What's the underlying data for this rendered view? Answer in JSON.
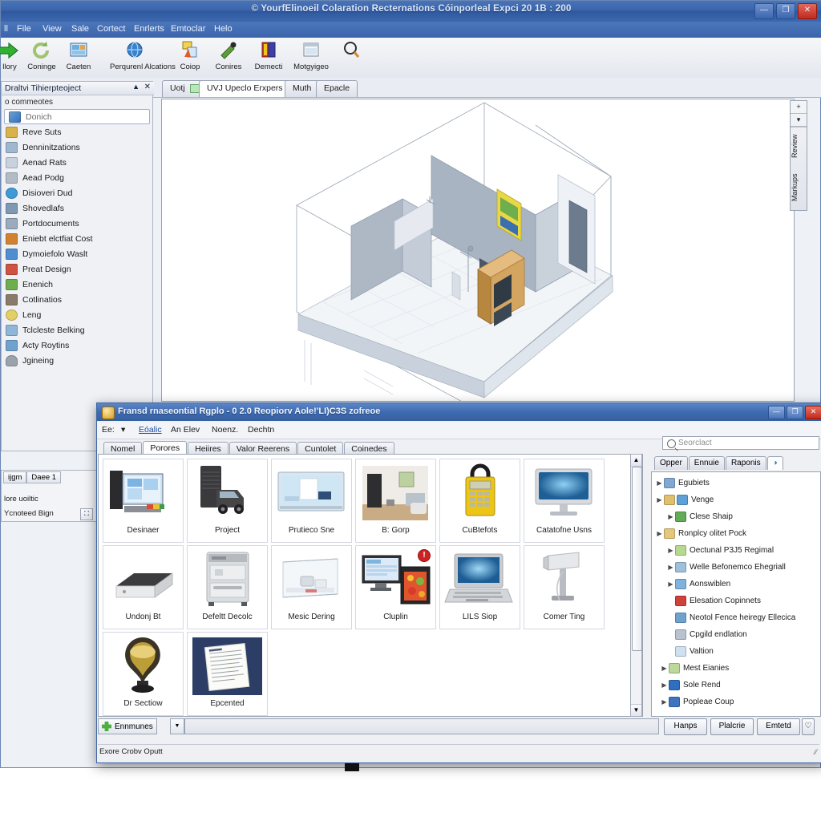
{
  "main_window": {
    "title": "© YourfElinoeil Colaration Recternations Cóinporleal Expci 20 1B : 200",
    "window_controls": [
      {
        "name": "minimize",
        "glyph": "—"
      },
      {
        "name": "restore",
        "glyph": "❐"
      },
      {
        "name": "close",
        "glyph": "✕"
      }
    ],
    "menubar": [
      "ll",
      "File",
      "View",
      "Sale",
      "Cortect",
      "Enrlerts",
      "Emtoclar",
      "Helo"
    ],
    "toolbar": [
      {
        "label": "llory",
        "icon": "green-arrow-icon",
        "color": "#27a128"
      },
      {
        "label": "Coninge",
        "icon": "refresh-icon",
        "color": "#9bc06a"
      },
      {
        "label": "Caeten",
        "icon": "screen-icon",
        "color": "#3d7fbf"
      },
      {
        "label": "Perqurenl Alcations",
        "icon": "globe-icon",
        "color": "#2f6fc4"
      },
      {
        "label": "Coiop",
        "icon": "color-chart-icon",
        "color": "#e6b329"
      },
      {
        "label": "Conires",
        "icon": "brush-icon",
        "color": "#4c8c36"
      },
      {
        "label": "Demecti",
        "icon": "book-icon",
        "color": "#b32d2d"
      },
      {
        "label": "Motgyigeo",
        "icon": "window-icon",
        "color": "#7b8897"
      },
      {
        "label": "",
        "icon": "search-icon",
        "color": "#3a3a3a"
      }
    ],
    "doc_tabs": [
      {
        "label": "Uotj",
        "active": false,
        "swatch": "#b6e8b8"
      },
      {
        "label": "UVJ Upeclo Erxpers",
        "active": true
      },
      {
        "label": "Muth",
        "active": false
      },
      {
        "label": "Epacle",
        "active": false
      }
    ],
    "viewport_vtabs": [
      {
        "label": "+",
        "square": true
      },
      {
        "label": "▾",
        "square": true
      },
      {
        "label": "Review",
        "square": false
      },
      {
        "label": "Markups",
        "square": false
      }
    ]
  },
  "left_panel": {
    "title": "Draltvi Tihierpteoject",
    "collapse_glyph": "▲",
    "close_glyph": "✕",
    "subtitle": "o commeotes",
    "search_value": "Donich",
    "search_icon": "search-list-icon",
    "items": [
      {
        "label": "Reve Suts",
        "color": "#d8b24a"
      },
      {
        "label": "Denninitzations",
        "color": "#9fb7cf"
      },
      {
        "label": "Aenad Rats",
        "color": "#c8d2de"
      },
      {
        "label": "Aead Podg",
        "color": "#b0bcc6"
      },
      {
        "label": "Disioveri Dud",
        "color": "#3f9ad6"
      },
      {
        "label": "Shovedlafs",
        "color": "#7f99b5"
      },
      {
        "label": "Portdocuments",
        "color": "#9aabbd"
      },
      {
        "label": "Eniebt elctfiat Cost",
        "color": "#d2822f"
      },
      {
        "label": "Dymoiefolo Waslt",
        "color": "#4f8fd0"
      },
      {
        "label": "Preat Design",
        "color": "#cf5340"
      },
      {
        "label": "Enenich",
        "color": "#6fae4c"
      },
      {
        "label": "Cotlinatios",
        "color": "#8a7a6c"
      },
      {
        "label": "Leng",
        "color": "#e3cf66"
      },
      {
        "label": "Tclcleste Belking",
        "color": "#8fb6d8"
      },
      {
        "label": "Acty Roytins",
        "color": "#6fa3cf"
      },
      {
        "label": "Jgineing",
        "color": "#9aa2ac"
      }
    ]
  },
  "lower_left_panel": {
    "tabs": [
      "ijgm",
      "Daee 1"
    ],
    "line1": "lore uoiltic",
    "line2": "Ycnoteed Bign",
    "button_glyph": "⛶"
  },
  "dialog": {
    "title": "Fransd rnaseontial Rgplo - 0 2.0 Reopiorv Aole!'LI)C3S zofreoe",
    "window_controls": [
      {
        "name": "minimize",
        "glyph": "—"
      },
      {
        "name": "restore",
        "glyph": "❐"
      },
      {
        "name": "close",
        "glyph": "✕"
      }
    ],
    "menubar": [
      "Ee:",
      "▾",
      "Eóalic",
      "An Elev",
      "Noenz.",
      "Dechtn"
    ],
    "tabs": [
      {
        "label": "Nomel",
        "active": false
      },
      {
        "label": "Porores",
        "active": true
      },
      {
        "label": "Heiires",
        "active": false
      },
      {
        "label": "Valor Reerens",
        "active": false
      },
      {
        "label": "Cuntolet",
        "active": false
      },
      {
        "label": "Coinedes",
        "active": false
      }
    ],
    "grid_items": [
      {
        "caption": "Desinaer",
        "thumb": "monitor-tower-icon"
      },
      {
        "caption": "Project",
        "thumb": "car-tower-icon"
      },
      {
        "caption": "Prutieco Sne",
        "thumb": "widescreen-icon"
      },
      {
        "caption": "B: Gorp",
        "thumb": "room-interior-icon"
      },
      {
        "caption": "CuBtefots",
        "thumb": "yellow-lockbox-icon"
      },
      {
        "caption": "Catatofne Usns",
        "thumb": "imac-icon"
      },
      {
        "caption": "Undonj Bt",
        "thumb": "flat-box-icon"
      },
      {
        "caption": "Defeltt Decolc",
        "thumb": "appliance-icon"
      },
      {
        "caption": "Mesic Dering",
        "thumb": "glass-case-icon"
      },
      {
        "caption": "Cluplin",
        "thumb": "monitor-fridge-icon",
        "badge": "!"
      },
      {
        "caption": "LILS Siop",
        "thumb": "laptop-icon"
      },
      {
        "caption": "Comer Ting",
        "thumb": "projector-icon"
      },
      {
        "caption": "Dr Sectiow",
        "thumb": "bulb-icon"
      },
      {
        "caption": "Epcented",
        "thumb": "document-icon"
      }
    ],
    "search": {
      "placeholder": "Seorclact",
      "icon": "search-icon"
    },
    "right_tabs": [
      {
        "label": "Opper",
        "active": false
      },
      {
        "label": "Ennuie",
        "active": false
      },
      {
        "label": "Raponis",
        "active": false
      },
      {
        "label": "◑",
        "active": true
      }
    ],
    "tree": [
      {
        "label": "Egubiets",
        "indent": 0,
        "arrow": "▶",
        "color": "#7fa9d4"
      },
      {
        "label": "Venge",
        "indent": 0,
        "arrow": "▶",
        "color": "#e0bf6e",
        "color2": "#5fa0d8"
      },
      {
        "label": "Clese Shaip",
        "indent": 1,
        "arrow": "▶",
        "color": "#62ab57"
      },
      {
        "label": "Ronplcy olitet Pock",
        "indent": 0,
        "arrow": "▶",
        "color": "#e3c77a"
      },
      {
        "label": "Oectunal P3J5 Regimal",
        "indent": 1,
        "arrow": "▶",
        "color": "#b7d98f"
      },
      {
        "label": "Welle Befonemco Ehegriall",
        "indent": 1,
        "arrow": "▶",
        "color": "#9fc0da"
      },
      {
        "label": "Aonswiblen",
        "indent": 1,
        "arrow": "▶",
        "color": "#7fb3dd"
      },
      {
        "label": "Elesation Copinnets",
        "indent": 2,
        "arrow": "",
        "color": "#d0413a"
      },
      {
        "label": "Neotol Fence heiregy Ellecica",
        "indent": 2,
        "arrow": "",
        "color": "#6fa3cf"
      },
      {
        "label": "Cpgild endlation",
        "indent": 2,
        "arrow": "",
        "color": "#b8c3cf"
      },
      {
        "label": "Valtion",
        "indent": 2,
        "arrow": "",
        "color": "#cfe0f0"
      },
      {
        "label": "Mest Eianies",
        "indent": 0,
        "arrow": "▶",
        "color": "#bcd89a"
      },
      {
        "label": "Sole Rend",
        "indent": 0,
        "arrow": "▶",
        "color": "#2f6fbf"
      },
      {
        "label": "Popleae Coup",
        "indent": 0,
        "arrow": "▶",
        "color": "#3d74c0"
      }
    ],
    "bottom": {
      "component_button": "Ennmunes",
      "component_icon": "green-puzzle-icon",
      "dropdown_glyph": "▼",
      "field_value": "",
      "actions": [
        "Hanps",
        "Plalcrie",
        "Emtetd",
        "♡",
        "?"
      ]
    },
    "statusbar": {
      "text": "Exore Crobv Oputt",
      "grip": "⁄⁄"
    }
  }
}
